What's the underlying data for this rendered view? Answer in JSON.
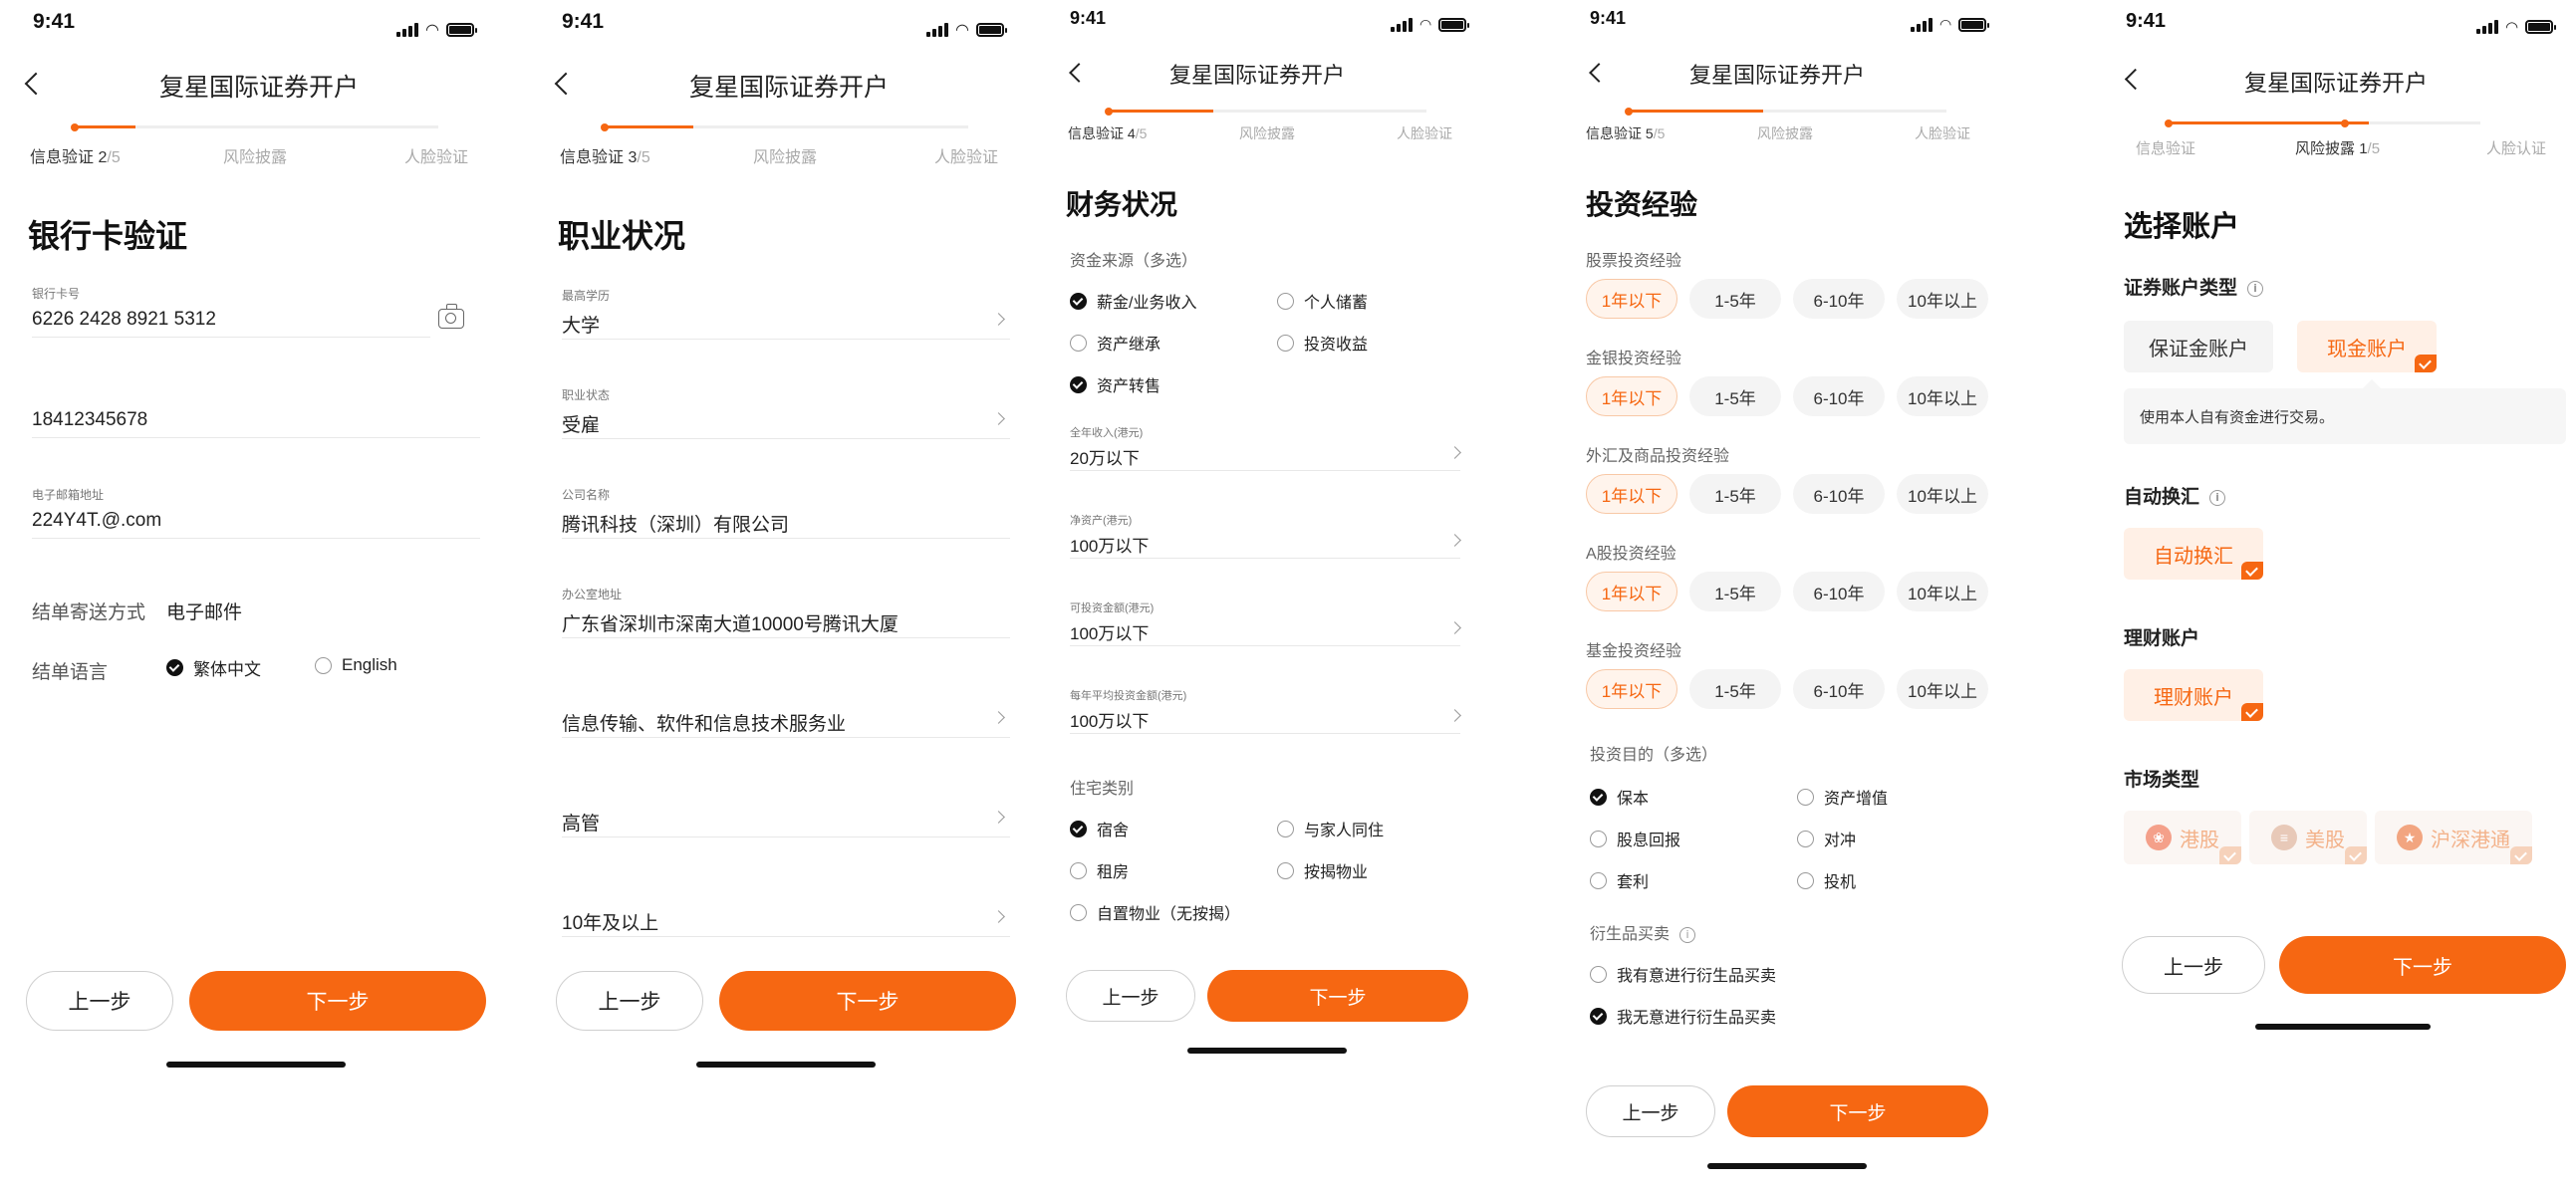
{
  "status_time": "9:41",
  "app_title": "复星国际证券开户",
  "colors": {
    "accent": "#f66712",
    "accent_light": "#fff4ec"
  },
  "steps": {
    "info": "信息验证",
    "risk": "风险披露",
    "face": "人脸验证",
    "face_alt": "人脸认证"
  },
  "buttons": {
    "prev": "上一步",
    "next": "下一步"
  },
  "s1": {
    "step_count": "2",
    "step_total": "/5",
    "page_title": "银行卡验证",
    "card_label": "银行卡号",
    "card_value": "6226 2428 8921 5312",
    "phone_value": "18412345678",
    "email_label": "电子邮箱地址",
    "email_value": "224Y4T.@.com",
    "delivery_label": "结单寄送方式",
    "delivery_value": "电子邮件",
    "language_label": "结单语言",
    "lang_options": [
      "繁体中文",
      "English"
    ]
  },
  "s2": {
    "step_count": "3",
    "step_total": "/5",
    "page_title": "职业状况",
    "fields": [
      {
        "label": "最高学历",
        "value": "大学"
      },
      {
        "label": "职业状态",
        "value": "受雇"
      },
      {
        "label": "公司名称",
        "value": "腾讯科技（深圳）有限公司"
      },
      {
        "label": "办公室地址",
        "value": "广东省深圳市深南大道10000号腾讯大厦"
      },
      {
        "label": "",
        "value": "信息传输、软件和信息技术服务业"
      },
      {
        "label": "",
        "value": "高管"
      },
      {
        "label": "",
        "value": "10年及以上"
      }
    ]
  },
  "s3": {
    "step_count": "4",
    "step_total": "/5",
    "page_title": "财务状况",
    "source_label": "资金来源（多选）",
    "sources": [
      "薪金/业务收入",
      "个人储蓄",
      "资产继承",
      "投资收益",
      "资产转售"
    ],
    "fields": [
      {
        "label": "全年收入(港元)",
        "value": "20万以下"
      },
      {
        "label": "净资产(港元)",
        "value": "100万以下"
      },
      {
        "label": "可投资金额(港元)",
        "value": "100万以下"
      },
      {
        "label": "每年平均投资金额(港元)",
        "value": "100万以下"
      }
    ],
    "housing_label": "住宅类别",
    "housing": [
      "宿舍",
      "与家人同住",
      "租房",
      "按揭物业",
      "自置物业（无按揭）"
    ]
  },
  "s4": {
    "step_count": "5",
    "step_total": "/5",
    "page_title": "投资经验",
    "exp_groups": [
      "股票投资经验",
      "金银投资经验",
      "外汇及商品投资经验",
      "A股投资经验",
      "基金投资经验"
    ],
    "exp_options": [
      "1年以下",
      "1-5年",
      "6-10年",
      "10年以上"
    ],
    "purpose_label": "投资目的（多选）",
    "purposes": [
      "保本",
      "资产增值",
      "股息回报",
      "对冲",
      "套利",
      "投机"
    ],
    "deriv_label": "衍生品买卖",
    "deriv_options": [
      "我有意进行衍生品买卖",
      "我无意进行衍生品买卖"
    ]
  },
  "s5": {
    "step_count": "1",
    "step_total": "/5",
    "page_title": "选择账户",
    "acct_type_label": "证券账户类型",
    "acct_types": [
      "保证金账户",
      "现金账户"
    ],
    "acct_tip": "使用本人自有资金进行交易。",
    "fx_label": "自动换汇",
    "fx_option": "自动换汇",
    "wealth_label": "理财账户",
    "wealth_option": "理财账户",
    "market_label": "市场类型",
    "markets": [
      "港股",
      "美股",
      "沪深港通"
    ]
  }
}
